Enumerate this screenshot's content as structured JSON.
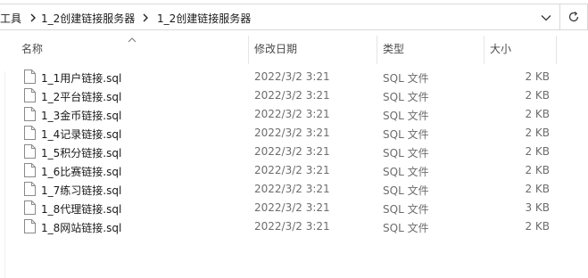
{
  "breadcrumb": {
    "items": [
      "工具",
      "1_2创建链接服务器",
      "1_2创建链接服务器"
    ]
  },
  "columns": {
    "name": "名称",
    "modified": "修改日期",
    "type": "类型",
    "size": "大小",
    "sorted_by": "name",
    "sort_direction": "ascending"
  },
  "files": [
    {
      "name": "1_1用户链接.sql",
      "modified": "2022/3/2 3:21",
      "type": "SQL 文件",
      "size": "2 KB"
    },
    {
      "name": "1_2平台链接.sql",
      "modified": "2022/3/2 3:21",
      "type": "SQL 文件",
      "size": "2 KB"
    },
    {
      "name": "1_3金币链接.sql",
      "modified": "2022/3/2 3:21",
      "type": "SQL 文件",
      "size": "2 KB"
    },
    {
      "name": "1_4记录链接.sql",
      "modified": "2022/3/2 3:21",
      "type": "SQL 文件",
      "size": "2 KB"
    },
    {
      "name": "1_5积分链接.sql",
      "modified": "2022/3/2 3:21",
      "type": "SQL 文件",
      "size": "2 KB"
    },
    {
      "name": "1_6比赛链接.sql",
      "modified": "2022/3/2 3:21",
      "type": "SQL 文件",
      "size": "2 KB"
    },
    {
      "name": "1_7练习链接.sql",
      "modified": "2022/3/2 3:21",
      "type": "SQL 文件",
      "size": "2 KB"
    },
    {
      "name": "1_8代理链接.sql",
      "modified": "2022/3/2 3:21",
      "type": "SQL 文件",
      "size": "3 KB"
    },
    {
      "name": "1_8网站链接.sql",
      "modified": "2022/3/2 3:21",
      "type": "SQL 文件",
      "size": "2 KB"
    }
  ],
  "icons": {
    "breadcrumb_separator": "chevron-right-icon",
    "history_dropdown": "chevron-down-icon",
    "refresh": "refresh-icon",
    "file": "file-icon",
    "sort": "sort-up-icon"
  },
  "colors": {
    "border": "#d9d9d9",
    "header_text": "#4a4a4a",
    "secondary_text": "#6d6d6d"
  }
}
